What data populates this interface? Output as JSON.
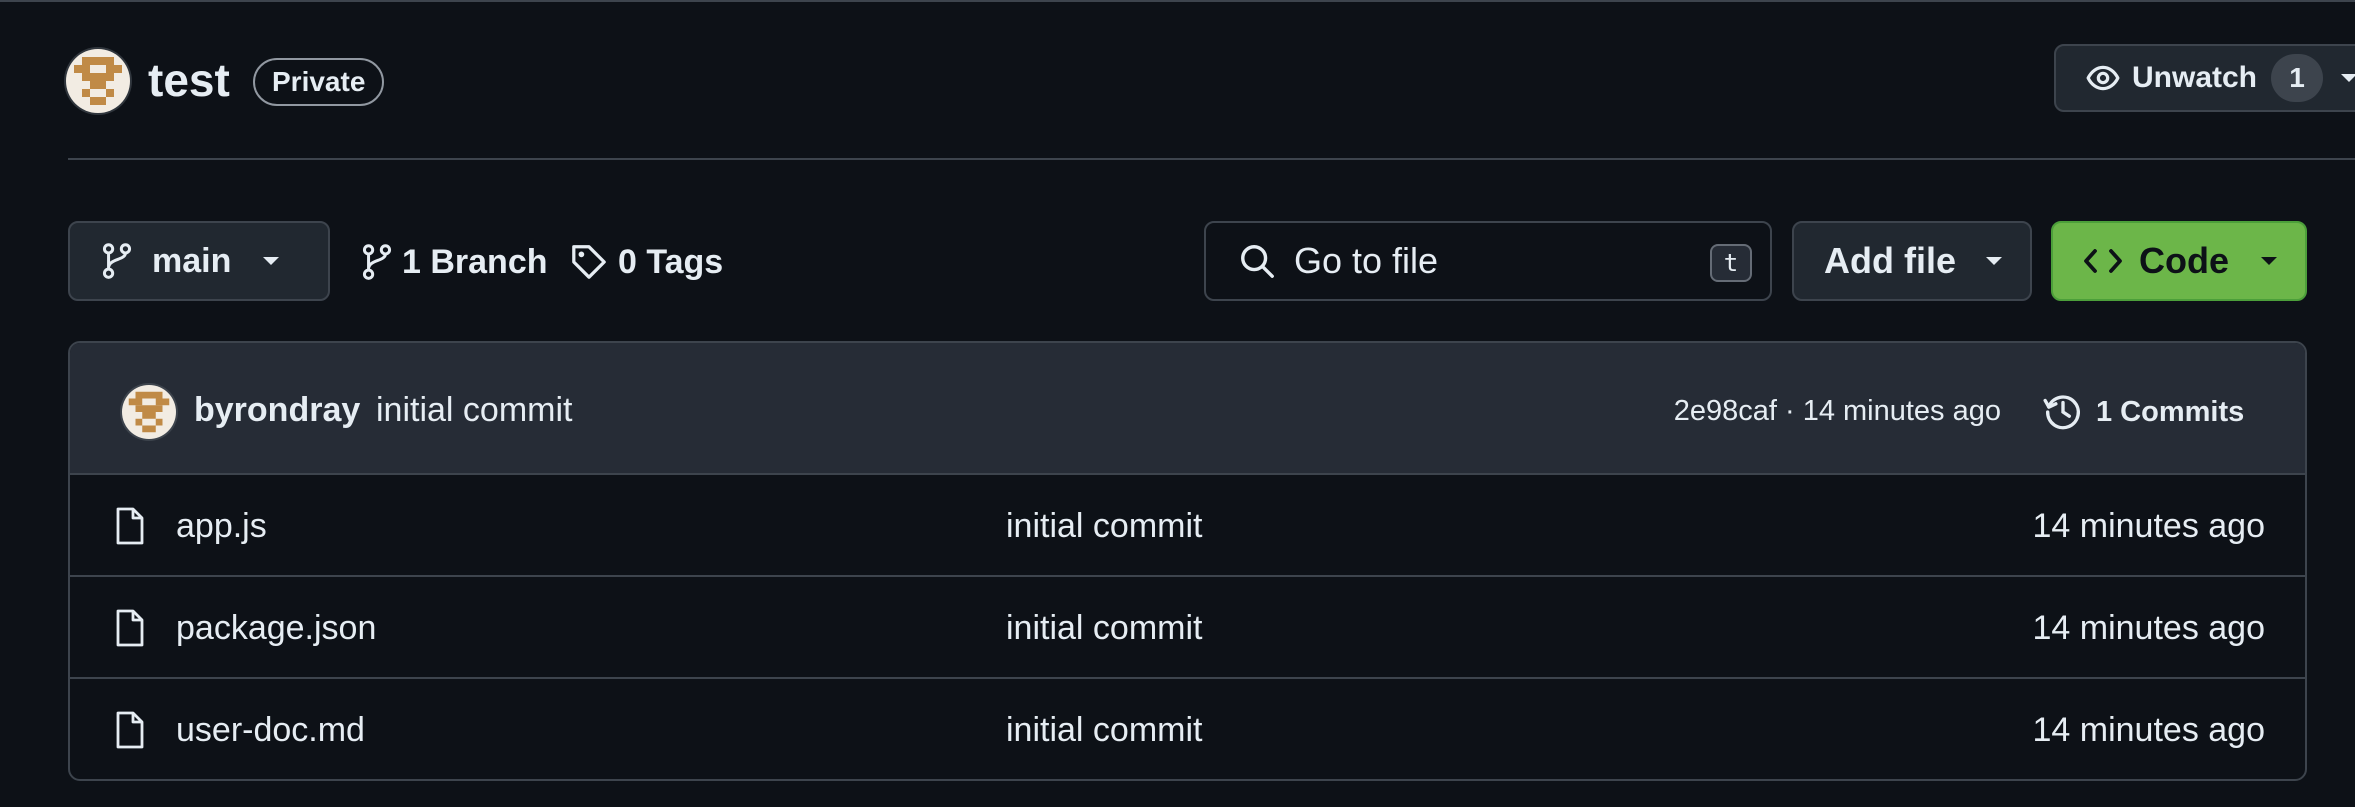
{
  "repo": {
    "name": "test",
    "visibility": "Private",
    "unwatch_label": "Unwatch",
    "watchers": "1"
  },
  "toolbar": {
    "branch": "main",
    "branch_count": "1 Branch",
    "tag_count": "0 Tags",
    "search_placeholder": "Go to file",
    "search_shortcut": "t",
    "add_file_label": "Add file",
    "code_label": "Code"
  },
  "latest_commit": {
    "author": "byrondray",
    "message": "initial commit",
    "sha": "2e98caf",
    "separator": "·",
    "time": "14 minutes ago",
    "commits_label": "1 Commits"
  },
  "files": [
    {
      "name": "app.js",
      "commit": "initial commit",
      "time": "14 minutes ago"
    },
    {
      "name": "package.json",
      "commit": "initial commit",
      "time": "14 minutes ago"
    },
    {
      "name": "user-doc.md",
      "commit": "initial commit",
      "time": "14 minutes ago"
    }
  ],
  "icons": {
    "eye": "eye-icon",
    "branch": "git-branch-icon",
    "tag": "tag-icon",
    "search": "search-icon",
    "code": "code-icon",
    "history": "history-icon",
    "file": "file-icon",
    "caret": "caret-down-icon"
  },
  "colors": {
    "background": "#0d1117",
    "border": "#3d444d",
    "button_bg": "#212830",
    "commit_bar_bg": "#262c36",
    "code_button_bg": "#6cb649",
    "text": "#e6edf3",
    "avatar_primary": "#c08a46"
  }
}
